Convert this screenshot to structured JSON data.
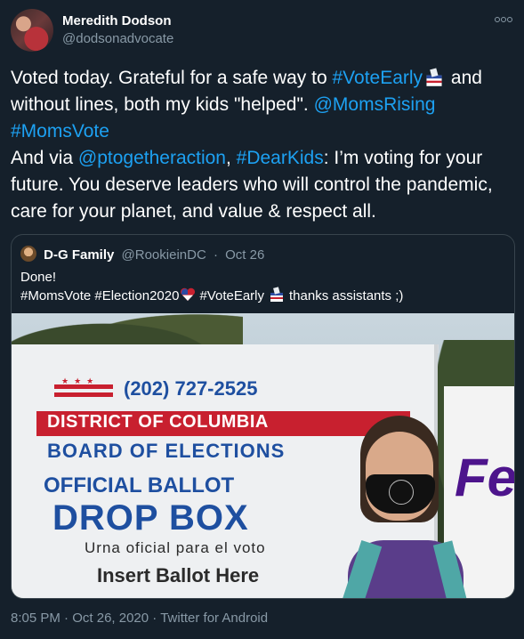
{
  "author": {
    "name": "Meredith Dodson",
    "handle": "@dodsonadvocate"
  },
  "tweet": {
    "segments": [
      {
        "t": "Voted today. Grateful for a safe way to ",
        "link": false
      },
      {
        "t": "#VoteEarly",
        "link": true
      },
      {
        "t": "🗳",
        "emoji": "ballot-box-icon"
      },
      {
        "t": " and without lines, both my kids \"helped\". ",
        "link": false
      },
      {
        "t": "@MomsRising",
        "link": true
      },
      {
        "t": "\n",
        "link": false
      },
      {
        "t": "#MomsVote",
        "link": true
      },
      {
        "t": "\nAnd via ",
        "link": false
      },
      {
        "t": "@ptogetheraction",
        "link": true
      },
      {
        "t": ", ",
        "link": false
      },
      {
        "t": "#DearKids",
        "link": true
      },
      {
        "t": ": I’m voting for your future. You deserve leaders who will control the pandemic, care for your planet, and value & respect all.",
        "link": false
      }
    ]
  },
  "quote": {
    "name": "D-G Family",
    "handle": "@RookieinDC",
    "date": "Oct 26",
    "line1": "Done!",
    "line2_parts": [
      "#MomsVote #Election2020",
      "#VoteEarly",
      "thanks assistants ;)"
    ]
  },
  "photo": {
    "phone": "(202) 727-2525",
    "district": "DISTRICT OF COLUMBIA",
    "board": "BOARD OF ELECTIONS",
    "official": "OFFICIAL BALLOT",
    "dropbox": "DROP BOX",
    "urna": "Urna oficial para el voto",
    "insert": "Insert Ballot Here",
    "truck": "Fe"
  },
  "footer": {
    "time": "8:05 PM",
    "date": "Oct 26, 2020",
    "client": "Twitter for Android",
    "separator": "·"
  },
  "colors": {
    "background": "#15202b",
    "link": "#1da1f2",
    "secondary": "#8899a6",
    "border": "#38444d"
  }
}
